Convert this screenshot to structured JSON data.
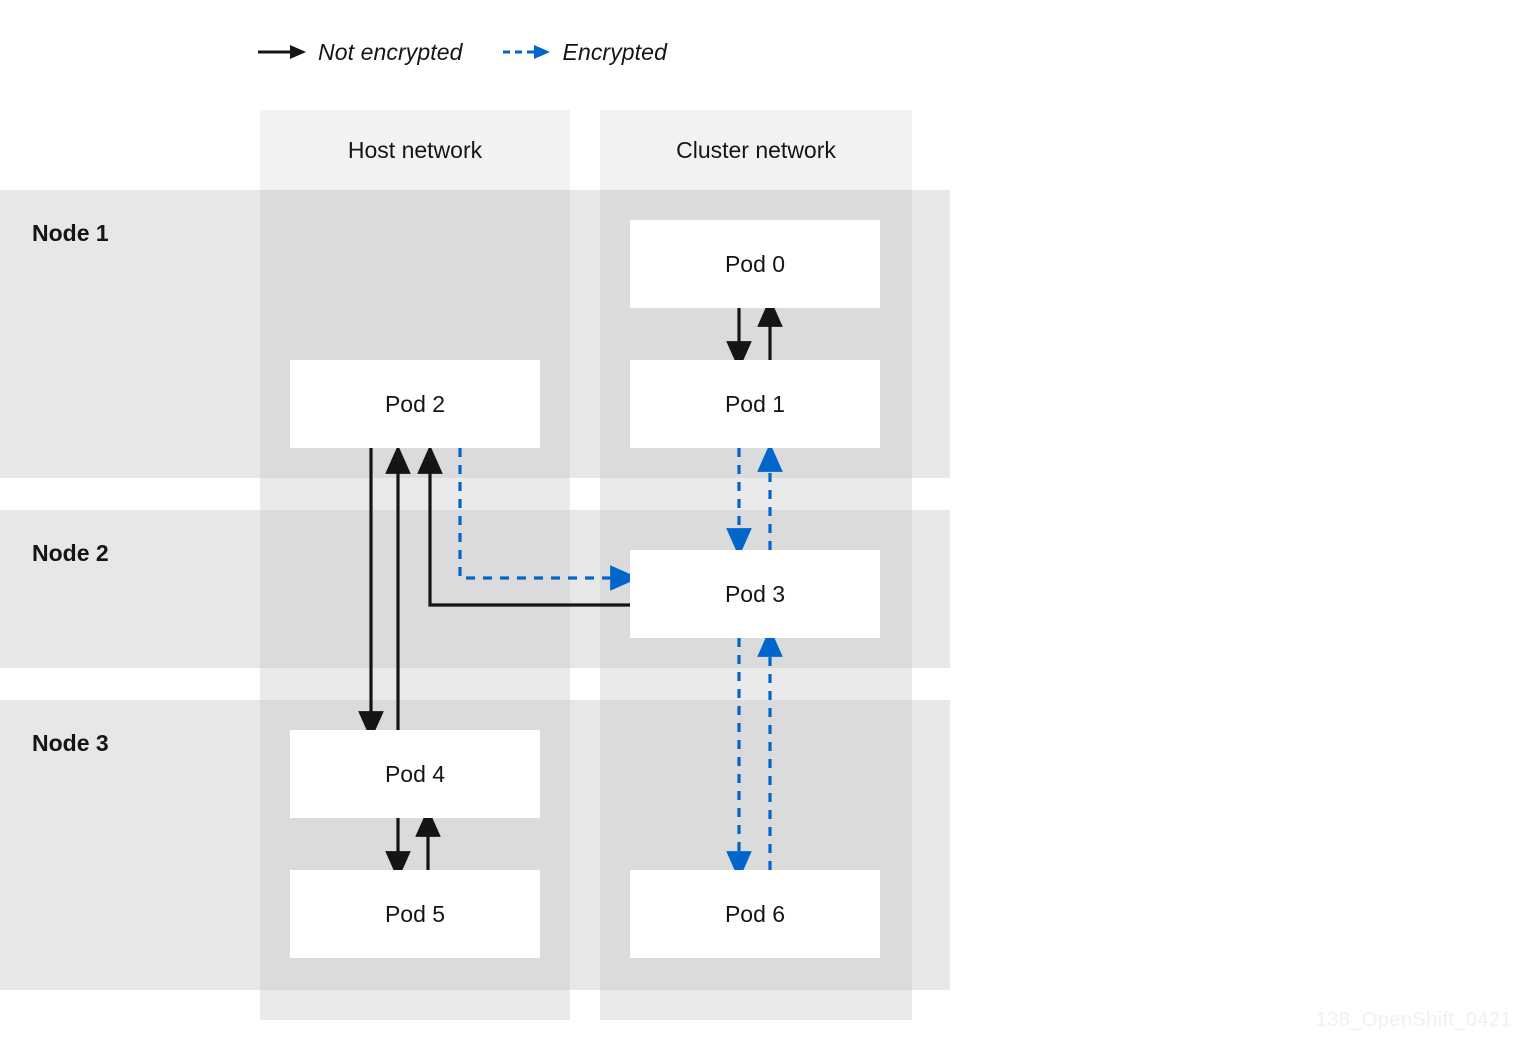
{
  "legend": {
    "items": [
      {
        "label": "Not encrypted",
        "style": "solid",
        "color": "#151515"
      },
      {
        "label": "Encrypted",
        "style": "dashed",
        "color": "#0066cc"
      }
    ]
  },
  "columns": [
    {
      "id": "host",
      "label": "Host network"
    },
    {
      "id": "cluster",
      "label": "Cluster network"
    }
  ],
  "nodes": [
    {
      "id": "node1",
      "label": "Node 1"
    },
    {
      "id": "node2",
      "label": "Node 2"
    },
    {
      "id": "node3",
      "label": "Node 3"
    }
  ],
  "pods": [
    {
      "id": "pod0",
      "label": "Pod 0",
      "node": "node1",
      "column": "cluster"
    },
    {
      "id": "pod1",
      "label": "Pod 1",
      "node": "node1",
      "column": "cluster"
    },
    {
      "id": "pod2",
      "label": "Pod 2",
      "node": "node1",
      "column": "host"
    },
    {
      "id": "pod3",
      "label": "Pod 3",
      "node": "node2",
      "column": "cluster"
    },
    {
      "id": "pod4",
      "label": "Pod 4",
      "node": "node3",
      "column": "host"
    },
    {
      "id": "pod5",
      "label": "Pod 5",
      "node": "node3",
      "column": "host"
    },
    {
      "id": "pod6",
      "label": "Pod 6",
      "node": "node3",
      "column": "cluster"
    }
  ],
  "connections": [
    {
      "from": "pod0",
      "to": "pod1",
      "encrypted": false
    },
    {
      "from": "pod1",
      "to": "pod0",
      "encrypted": false
    },
    {
      "from": "pod1",
      "to": "pod3",
      "encrypted": true
    },
    {
      "from": "pod3",
      "to": "pod1",
      "encrypted": true
    },
    {
      "from": "pod2",
      "to": "pod3",
      "encrypted": true
    },
    {
      "from": "pod3",
      "to": "pod2",
      "encrypted": false
    },
    {
      "from": "pod2",
      "to": "pod4",
      "encrypted": false
    },
    {
      "from": "pod4",
      "to": "pod2",
      "encrypted": false
    },
    {
      "from": "pod4",
      "to": "pod5",
      "encrypted": false
    },
    {
      "from": "pod5",
      "to": "pod4",
      "encrypted": false
    },
    {
      "from": "pod3",
      "to": "pod6",
      "encrypted": true
    },
    {
      "from": "pod6",
      "to": "pod3",
      "encrypted": true
    }
  ],
  "colors": {
    "encrypted": "#0066cc",
    "not_encrypted": "#151515",
    "node_band": "#e7e7e7",
    "column_header": "#f2f2f2",
    "pod_fill": "#ffffff",
    "text": "#151515"
  },
  "watermark": "138_OpenShift_0421"
}
